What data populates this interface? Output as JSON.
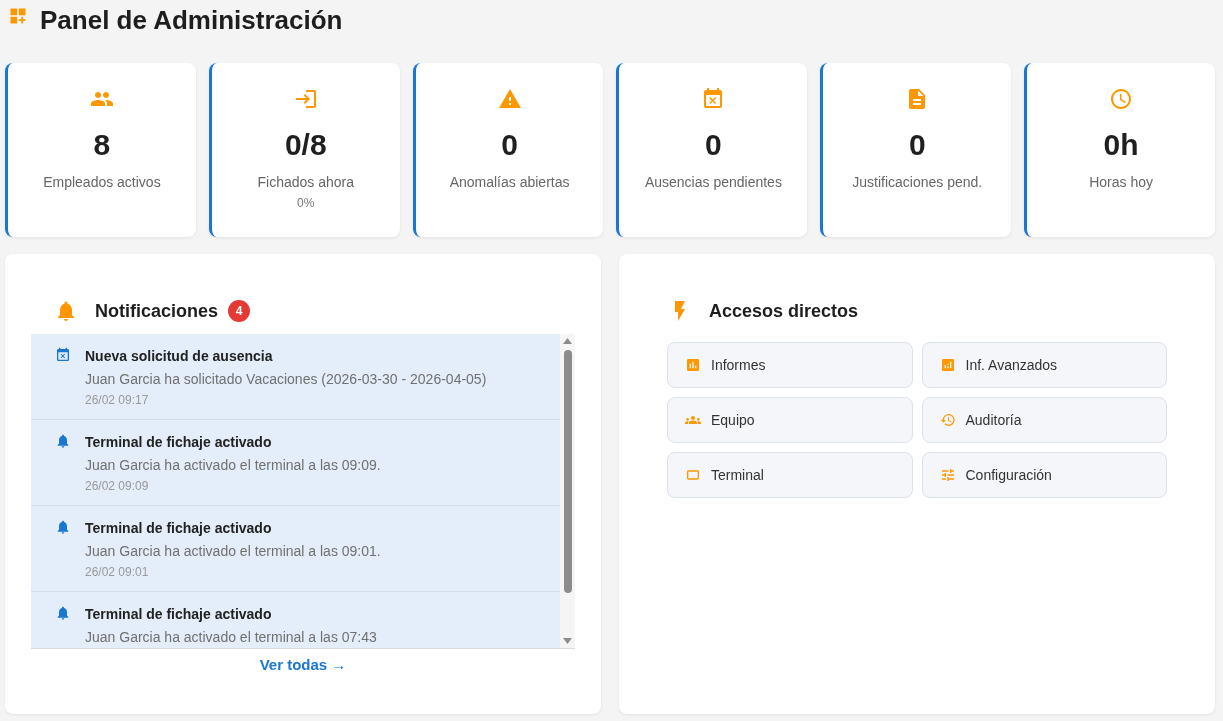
{
  "header": {
    "title": "Panel de Administración"
  },
  "stats": [
    {
      "value": "8",
      "label": "Empleados activos"
    },
    {
      "value": "0/8",
      "label": "Fichados ahora",
      "sublabel": "0%"
    },
    {
      "value": "0",
      "label": "Anomalías abiertas"
    },
    {
      "value": "0",
      "label": "Ausencias pendientes"
    },
    {
      "value": "0",
      "label": "Justificaciones pend."
    },
    {
      "value": "0h",
      "label": "Horas hoy"
    }
  ],
  "notifications": {
    "title": "Notificaciones",
    "badge": "4",
    "items": [
      {
        "kind": "absence",
        "unread": true,
        "title": "Nueva solicitud de ausencia",
        "message": "Juan Garcia ha solicitado Vacaciones (2026-03-30 - 2026-04-05)",
        "time": "26/02 09:17"
      },
      {
        "kind": "terminal",
        "unread": true,
        "title": "Terminal de fichaje activado",
        "message": "Juan Garcia ha activado el terminal a las 09:09.",
        "time": "26/02 09:09"
      },
      {
        "kind": "terminal",
        "unread": true,
        "title": "Terminal de fichaje activado",
        "message": "Juan Garcia ha activado el terminal a las 09:01.",
        "time": "26/02 09:01"
      },
      {
        "kind": "terminal",
        "unread": true,
        "title": "Terminal de fichaje activado",
        "message": "Juan Garcia ha activado el terminal a las 07:43"
      }
    ],
    "link": "Ver todas →"
  },
  "shortcuts": {
    "title": "Accesos directos",
    "items": [
      {
        "label": "Informes"
      },
      {
        "label": "Inf. Avanzados"
      },
      {
        "label": "Equipo"
      },
      {
        "label": "Auditoría"
      },
      {
        "label": "Terminal"
      },
      {
        "label": "Configuración"
      }
    ]
  }
}
